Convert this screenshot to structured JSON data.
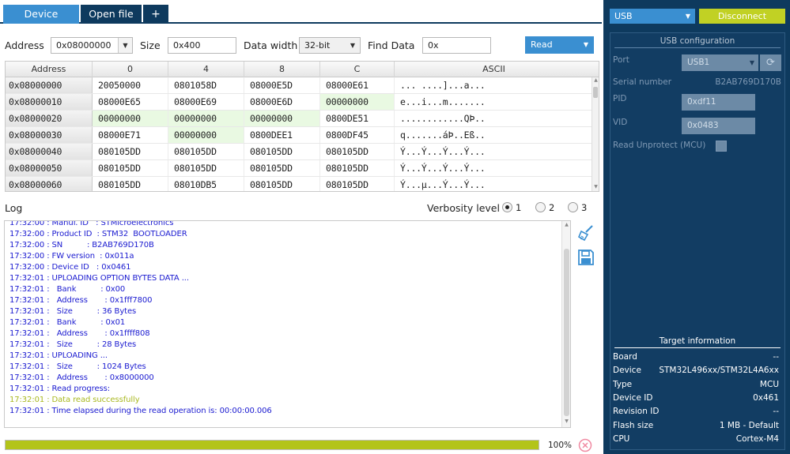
{
  "tabs": [
    {
      "label": "Device memory",
      "active": true
    },
    {
      "label": "Open file",
      "active": false
    },
    {
      "label": "+",
      "active": false
    }
  ],
  "toolbar": {
    "address_label": "Address",
    "address_value": "0x08000000",
    "size_label": "Size",
    "size_value": "0x400",
    "data_width_label": "Data width",
    "data_width_value": "32-bit",
    "find_label": "Find Data",
    "find_value": "0x",
    "read_label": "Read"
  },
  "memory": {
    "columns": [
      "Address",
      "0",
      "4",
      "8",
      "C",
      "ASCII"
    ],
    "rows": [
      {
        "addr": "0x08000000",
        "c0": "20050000",
        "c4": "0801058D",
        "c8": "08000E5D",
        "cC": "08000E61",
        "ascii": "... ....]...a..."
      },
      {
        "addr": "0x08000010",
        "c0": "08000E65",
        "c4": "08000E69",
        "c8": "08000E6D",
        "cC": "00000000",
        "ascii": "e...i...m......."
      },
      {
        "addr": "0x08000020",
        "c0": "00000000",
        "c4": "00000000",
        "c8": "00000000",
        "cC": "0800DE51",
        "ascii": "............QÞ.."
      },
      {
        "addr": "0x08000030",
        "c0": "08000E71",
        "c4": "00000000",
        "c8": "0800DEE1",
        "cC": "0800DF45",
        "ascii": "q.......áÞ..Eß.."
      },
      {
        "addr": "0x08000040",
        "c0": "080105DD",
        "c4": "080105DD",
        "c8": "080105DD",
        "cC": "080105DD",
        "ascii": "Ý...Ý...Ý...Ý..."
      },
      {
        "addr": "0x08000050",
        "c0": "080105DD",
        "c4": "080105DD",
        "c8": "080105DD",
        "cC": "080105DD",
        "ascii": "Ý...Ý...Ý...Ý..."
      },
      {
        "addr": "0x08000060",
        "c0": "080105DD",
        "c4": "08010DB5",
        "c8": "080105DD",
        "cC": "080105DD",
        "ascii": "Ý...µ...Ý...Ý..."
      }
    ]
  },
  "log": {
    "label": "Log",
    "verbosity_label": "Verbosity level",
    "verbosity_options": [
      "1",
      "2",
      "3"
    ],
    "lines": [
      {
        "text": "17:32:00 : Manuf. ID   : STMicroelectronics",
        "ok": false
      },
      {
        "text": "17:32:00 : Product ID  : STM32  BOOTLOADER",
        "ok": false
      },
      {
        "text": "17:32:00 : SN          : B2AB769D170B",
        "ok": false
      },
      {
        "text": "17:32:00 : FW version  : 0x011a",
        "ok": false
      },
      {
        "text": "17:32:00 : Device ID   : 0x0461",
        "ok": false
      },
      {
        "text": "17:32:01 : UPLOADING OPTION BYTES DATA ...",
        "ok": false
      },
      {
        "text": "17:32:01 :   Bank          : 0x00",
        "ok": false
      },
      {
        "text": "17:32:01 :   Address       : 0x1fff7800",
        "ok": false
      },
      {
        "text": "17:32:01 :   Size          : 36 Bytes",
        "ok": false
      },
      {
        "text": "17:32:01 :   Bank          : 0x01",
        "ok": false
      },
      {
        "text": "17:32:01 :   Address       : 0x1ffff808",
        "ok": false
      },
      {
        "text": "17:32:01 :   Size          : 28 Bytes",
        "ok": false
      },
      {
        "text": "17:32:01 : UPLOADING ...",
        "ok": false
      },
      {
        "text": "17:32:01 :   Size          : 1024 Bytes",
        "ok": false
      },
      {
        "text": "17:32:01 :   Address       : 0x8000000",
        "ok": false
      },
      {
        "text": "17:32:01 : Read progress:",
        "ok": false
      },
      {
        "text": "17:32:01 : Data read successfully",
        "ok": true
      },
      {
        "text": "17:32:01 : Time elapsed during the read operation is: 00:00:00.006",
        "ok": false
      }
    ]
  },
  "progress": {
    "value": 1.0,
    "label": "100%"
  },
  "connection": {
    "interface": "USB",
    "disconnect_label": "Disconnect"
  },
  "usb_config": {
    "title": "USB configuration",
    "port_label": "Port",
    "port_value": "USB1",
    "serial_label": "Serial number",
    "serial_value": "B2AB769D170B",
    "pid_label": "PID",
    "pid_value": "0xdf11",
    "vid_label": "VID",
    "vid_value": "0x0483",
    "unprotect_label": "Read Unprotect (MCU)"
  },
  "target_info": {
    "title": "Target information",
    "rows": [
      {
        "label": "Board",
        "value": "--"
      },
      {
        "label": "Device",
        "value": "STM32L496xx/STM32L4A6xx"
      },
      {
        "label": "Type",
        "value": "MCU"
      },
      {
        "label": "Device ID",
        "value": "0x461"
      },
      {
        "label": "Revision ID",
        "value": "--"
      },
      {
        "label": "Flash size",
        "value": "1 MB - Default"
      },
      {
        "label": "CPU",
        "value": "Cortex-M4"
      }
    ]
  },
  "colors": {
    "navy": "#0e3a5e",
    "accent_blue": "#3a8fd1",
    "accent_green": "#c1d124",
    "log_blue": "#1a1ad0",
    "log_success": "#a9b820",
    "cell_highlight": "#e9f9e2"
  },
  "icons": {
    "clear_log": "broom-icon",
    "save_log": "save-icon",
    "cancel": "cancel-icon",
    "refresh": "refresh-icon"
  }
}
